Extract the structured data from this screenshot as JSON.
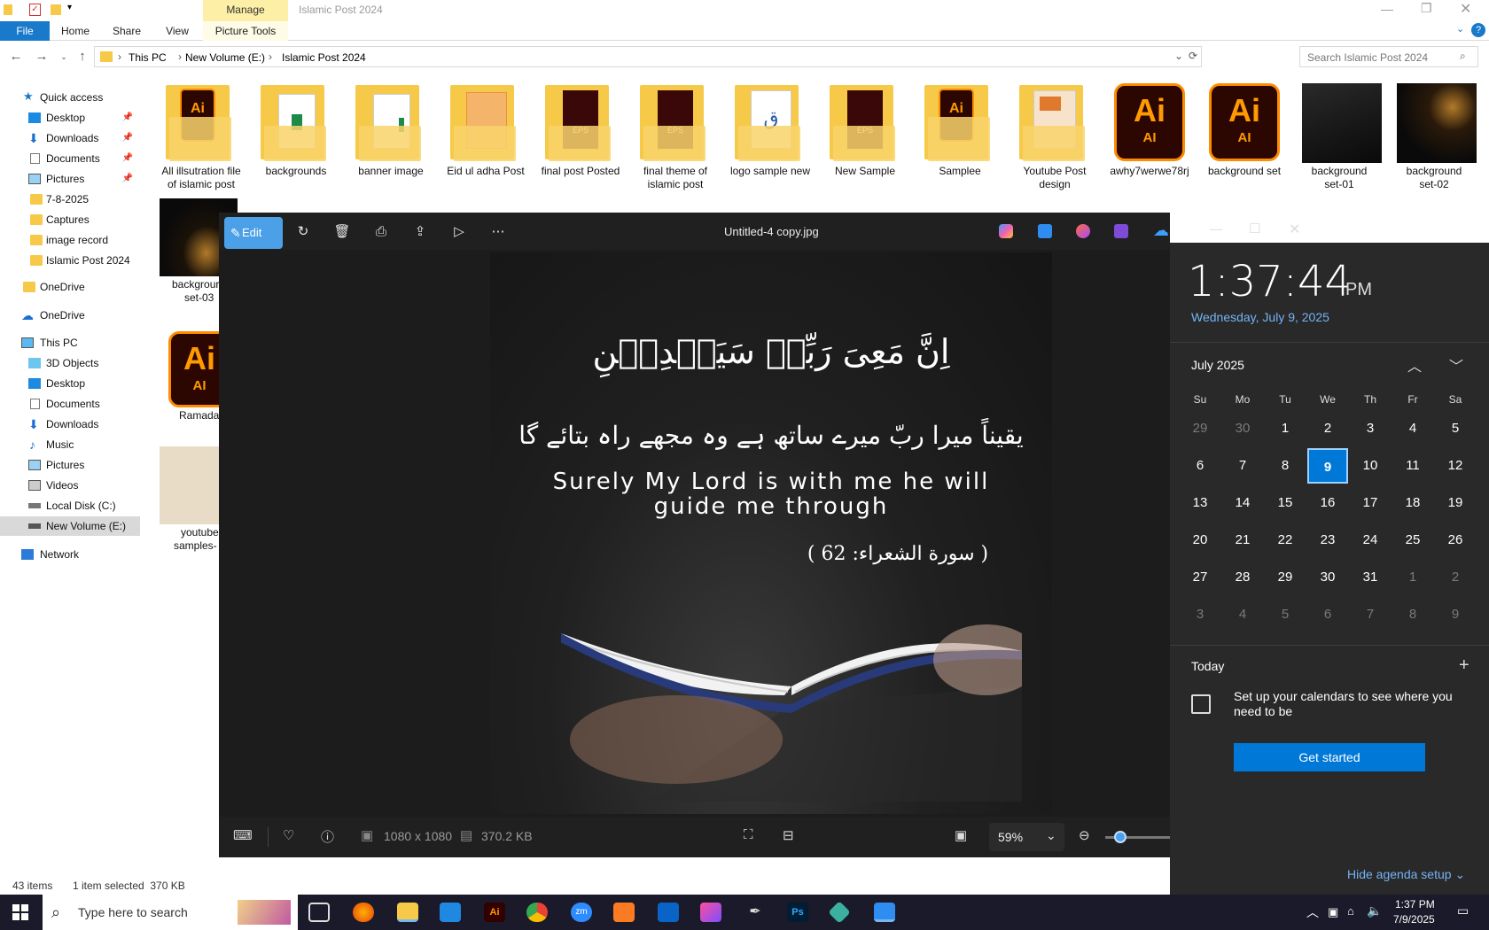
{
  "explorer": {
    "title": "Islamic Post 2024",
    "manage_tab": "Manage",
    "ribbon_tabs": [
      "Home",
      "Share",
      "View"
    ],
    "file_tab": "File",
    "picture_tools": "Picture Tools",
    "address": {
      "this_pc": "This PC",
      "volume": "New Volume (E:)",
      "folder": "Islamic Post 2024"
    },
    "search_placeholder": "Search Islamic Post 2024",
    "sidebar": {
      "quick_access": "Quick access",
      "qa_items": [
        "Desktop",
        "Downloads",
        "Documents",
        "Pictures",
        "7-8-2025",
        "Captures",
        "image record",
        "Islamic Post 2024"
      ],
      "onedrive1": "OneDrive",
      "onedrive2": "OneDrive",
      "this_pc": "This PC",
      "pc_items": [
        "3D Objects",
        "Desktop",
        "Documents",
        "Downloads",
        "Music",
        "Pictures",
        "Videos",
        "Local Disk (C:)",
        "New Volume (E:)"
      ],
      "network": "Network"
    },
    "tiles_row1": [
      {
        "l1": "All illsutration file",
        "l2": "of islamic post",
        "kind": "folder-ai"
      },
      {
        "l1": "backgrounds",
        "l2": "",
        "kind": "folder-sheet"
      },
      {
        "l1": "banner image",
        "l2": "",
        "kind": "folder-paper"
      },
      {
        "l1": "Eid ul adha Post",
        "l2": "",
        "kind": "folder-eid"
      },
      {
        "l1": "final post Posted",
        "l2": "",
        "kind": "folder-eps"
      },
      {
        "l1": "final theme of",
        "l2": "islamic post",
        "kind": "folder-eps"
      },
      {
        "l1": "logo sample new",
        "l2": "",
        "kind": "folder-logo"
      },
      {
        "l1": "New Sample",
        "l2": "",
        "kind": "folder-eps"
      },
      {
        "l1": "Samplee",
        "l2": "",
        "kind": "folder-ai"
      },
      {
        "l1": "Youtube Post",
        "l2": "design",
        "kind": "folder-yt"
      },
      {
        "l1": "awhy7werwe78rj",
        "l2": "",
        "kind": "ai"
      },
      {
        "l1": "background set",
        "l2": "",
        "kind": "ai"
      },
      {
        "l1": "background",
        "l2": "set-01",
        "kind": "img"
      },
      {
        "l1": "background",
        "l2": "set-02",
        "kind": "img"
      }
    ],
    "tile_row2_first": {
      "l1": "backgrour",
      "l2": "set-03"
    },
    "tile_ai_label": "Ramadar",
    "tile_ai_text": "Ai",
    "tile_ai_sub": "AI",
    "tile_yt": {
      "l1": "youtube",
      "l2": "samples-"
    },
    "status_items": "43 items",
    "status_selected": "1 item selected  370 KB"
  },
  "viewer": {
    "edit_label": "Edit",
    "filename": "Untitled-4 copy.jpg",
    "arabic": "اِنَّ مَعِیَ رَبِّیۡ سَیَهۡدِیۡنِ",
    "urdu": "یقیناً میرا ربّ میرے ساتھ ہے وہ مجھے راہ بتائے گا",
    "english_line1": "Surely My Lord is with me he will",
    "english_line2": "guide me through",
    "surah": "( سورة الشعراء: 62 )",
    "dimensions": "1080 x 1080",
    "filesize": "370.2 KB",
    "zoom": "59%"
  },
  "calendar": {
    "time": "1:37:44",
    "ampm": "PM",
    "date": "Wednesday, July 9, 2025",
    "month": "July 2025",
    "weekdays": [
      "Su",
      "Mo",
      "Tu",
      "We",
      "Th",
      "Fr",
      "Sa"
    ],
    "weeks": [
      [
        "29",
        "30",
        "1",
        "2",
        "3",
        "4",
        "5"
      ],
      [
        "6",
        "7",
        "8",
        "9",
        "10",
        "11",
        "12"
      ],
      [
        "13",
        "14",
        "15",
        "16",
        "17",
        "18",
        "19"
      ],
      [
        "20",
        "21",
        "22",
        "23",
        "24",
        "25",
        "26"
      ],
      [
        "27",
        "28",
        "29",
        "30",
        "31",
        "1",
        "2"
      ],
      [
        "3",
        "4",
        "5",
        "6",
        "7",
        "8",
        "9"
      ]
    ],
    "today_label": "Today",
    "setup_text": "Set up your calendars to see where you need to be",
    "get_started": "Get started",
    "hide_agenda": "Hide agenda setup"
  },
  "taskbar": {
    "search_placeholder": "Type here to search",
    "time": "1:37 PM",
    "date": "7/9/2025",
    "zoom_icon_text": "zm",
    "ps_text": "Ps",
    "ai_text": "Ai"
  },
  "colors": {
    "accent": "#0078d7",
    "today_border": "#9fd0ff",
    "ai_orange": "#ff9a00",
    "ai_bg": "#2c0701"
  }
}
